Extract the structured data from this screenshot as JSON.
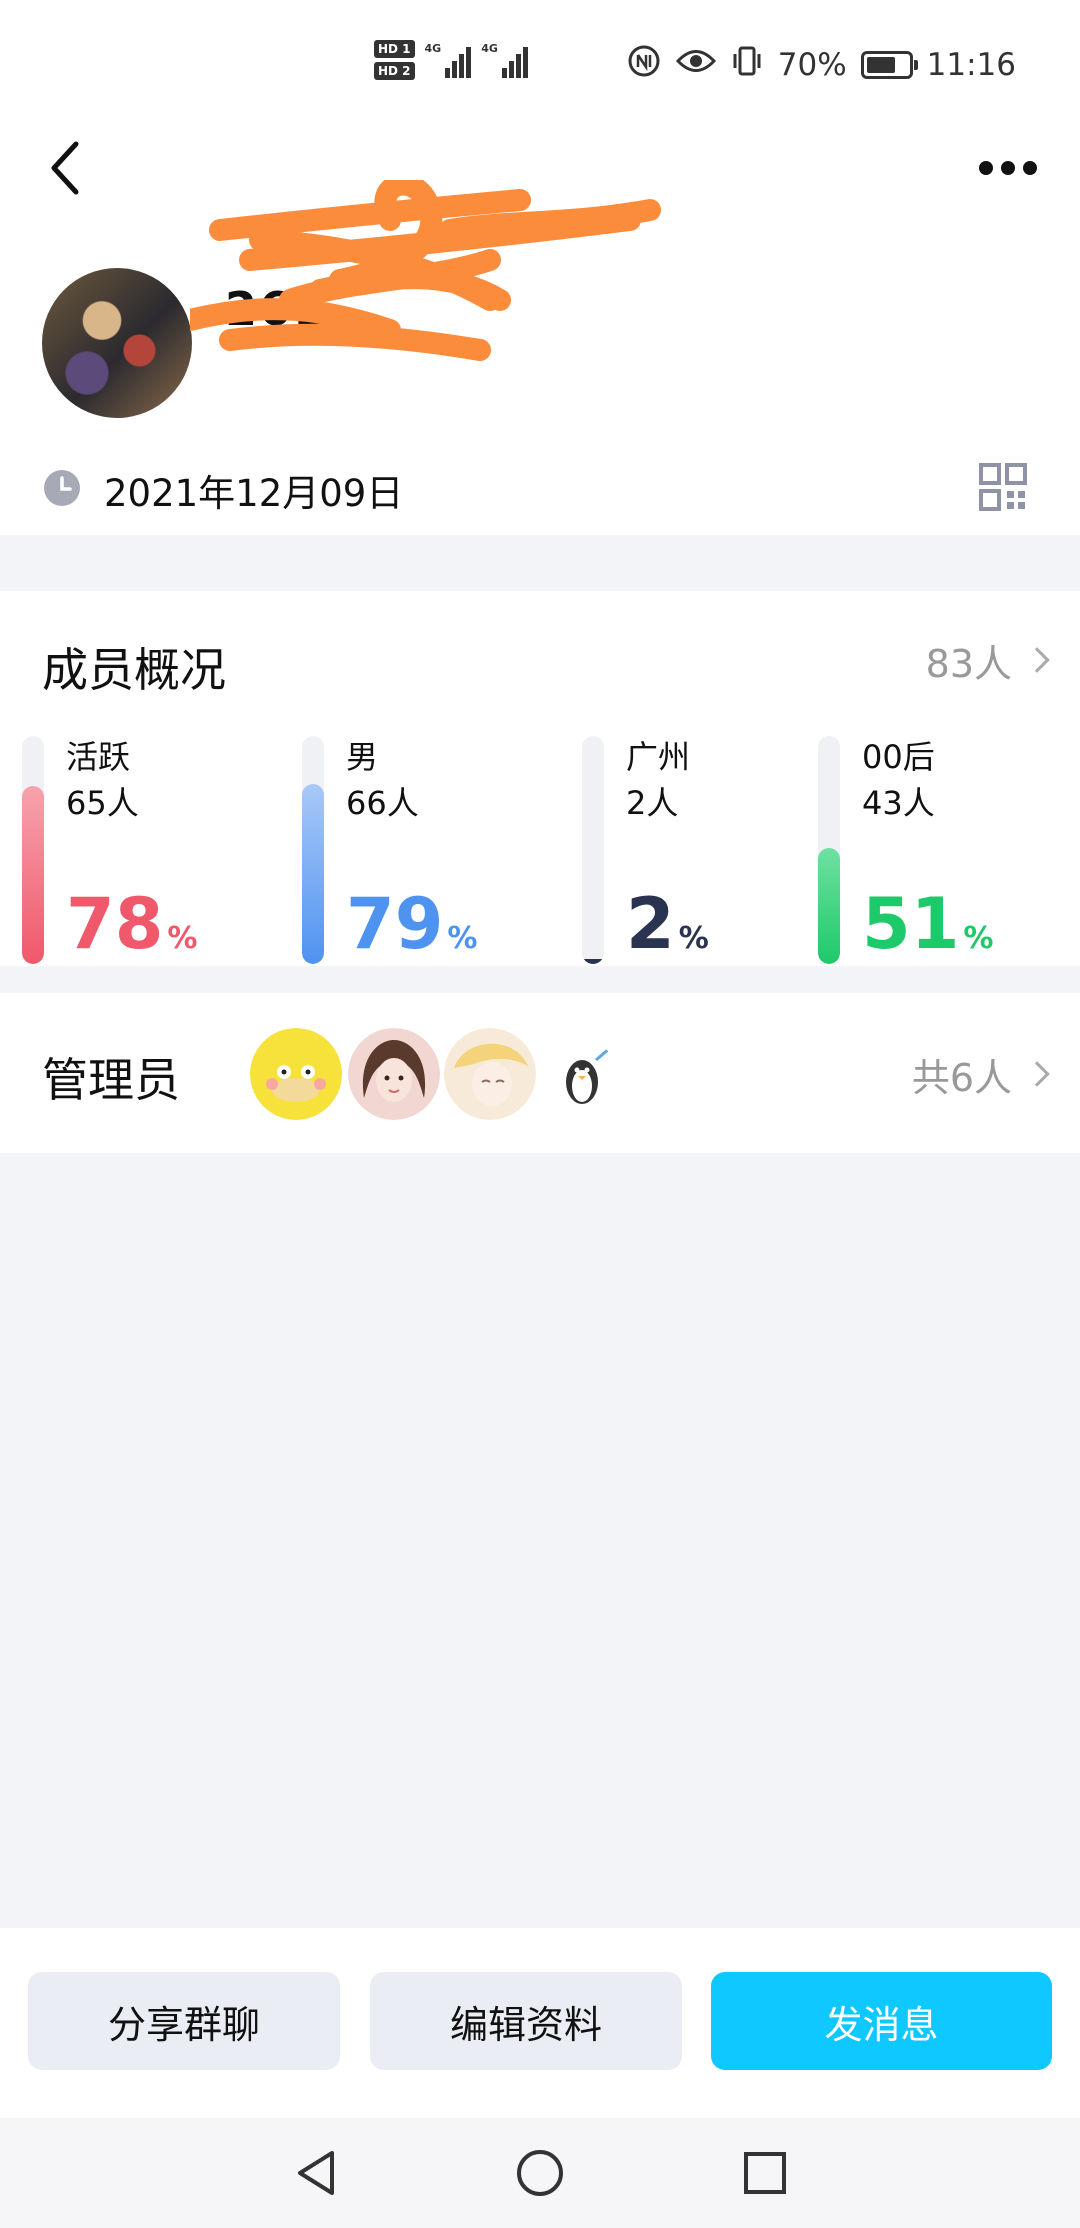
{
  "status_bar": {
    "sim1_label": "HD 1",
    "sim2_label": "HD 2",
    "network_type": "4G",
    "battery_percent": "70%",
    "battery_level": 0.7,
    "time": "11:16",
    "icons": [
      "nfc-icon",
      "eye-icon",
      "vibrate-icon",
      "battery-icon"
    ]
  },
  "header": {
    "group_name": "261",
    "group_id": "",
    "created_date": "2021年12月09日",
    "more_icon": "more-dots-icon",
    "back_icon": "back-arrow-icon",
    "qr_icon": "qr-code-icon"
  },
  "members": {
    "title": "成员概况",
    "total": "83人",
    "stats": [
      {
        "label": "活跃",
        "count": "65人",
        "percent": "78",
        "sign": "%",
        "fill": 0.78,
        "color": "#f0586b",
        "fill_top": "#f6a3ad"
      },
      {
        "label": "男",
        "count": "66人",
        "percent": "79",
        "sign": "%",
        "fill": 0.79,
        "color": "#4f93f0",
        "fill_top": "#a9c9f7"
      },
      {
        "label": "广州",
        "count": "2人",
        "percent": "2",
        "sign": "%",
        "fill": 0.02,
        "color": "#2a3350",
        "fill_top": "#2a3350"
      },
      {
        "label": "00后",
        "count": "43人",
        "percent": "51",
        "sign": "%",
        "fill": 0.51,
        "color": "#1ec96a",
        "fill_top": "#6fe1a1"
      }
    ]
  },
  "admins": {
    "title": "管理员",
    "total": "共6人"
  },
  "actions": {
    "share_label": "分享群聊",
    "edit_label": "编辑资料",
    "message_label": "发消息"
  },
  "colors": {
    "accent": "#0ec8ff",
    "active": "#f0586b",
    "male": "#4f93f0",
    "location": "#2a3350",
    "post00": "#1ec96a"
  }
}
